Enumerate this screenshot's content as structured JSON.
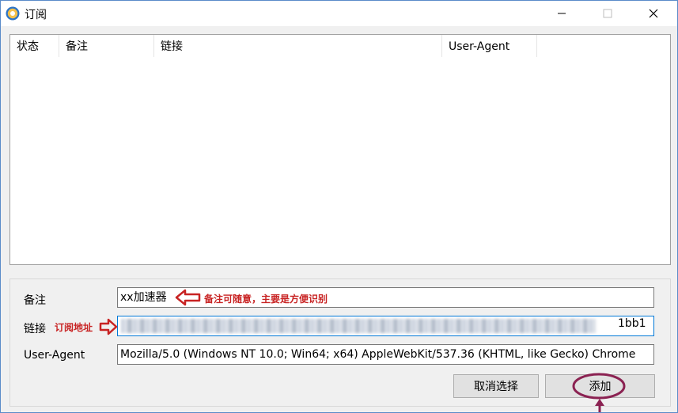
{
  "window": {
    "title": "订阅",
    "min_icon": "minimize-icon",
    "max_icon": "maximize-icon",
    "close_icon": "close-icon"
  },
  "table": {
    "columns": [
      "状态",
      "备注",
      "链接",
      "User-Agent"
    ],
    "rows": []
  },
  "form": {
    "remark": {
      "label": "备注",
      "value": "xx加速器"
    },
    "link": {
      "label": "链接",
      "value_visible_suffix": "1bb1"
    },
    "user_agent": {
      "label": "User-Agent",
      "value": "Mozilla/5.0 (Windows NT 10.0; Win64; x64) AppleWebKit/537.36 (KHTML, like Gecko) Chrome"
    }
  },
  "buttons": {
    "cancel": "取消选择",
    "add": "添加"
  },
  "annotations": {
    "remark_note": "备注可随意，主要是方便识别",
    "link_note": "订阅地址",
    "color": "#c82323",
    "highlight_color": "#8b2252"
  }
}
